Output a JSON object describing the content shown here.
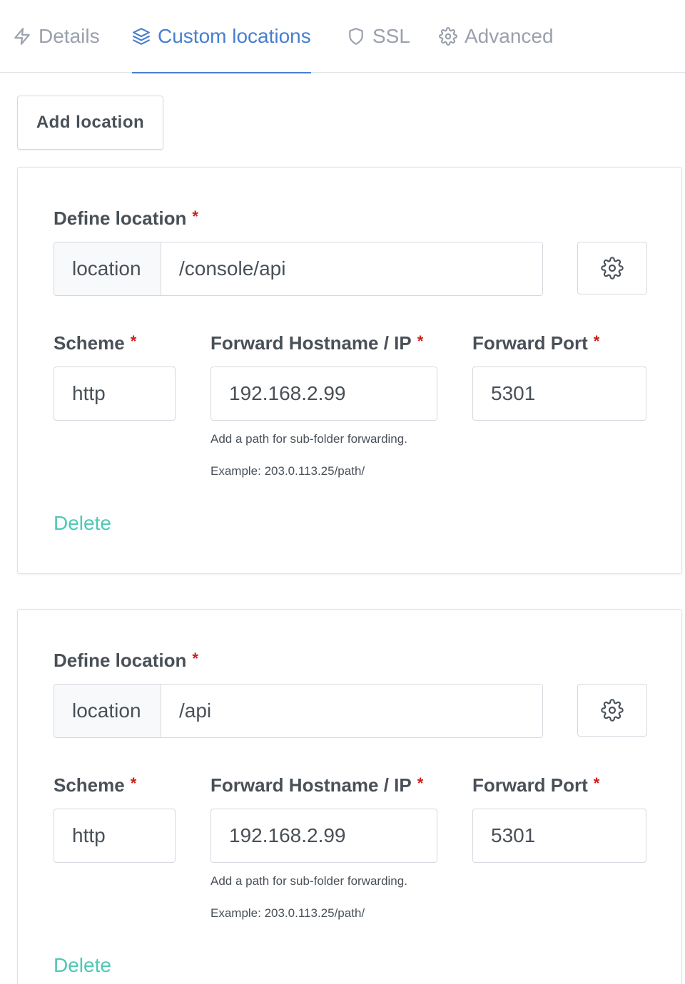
{
  "tabs": [
    {
      "label": "Details",
      "icon": "lightning-icon"
    },
    {
      "label": "Custom locations",
      "icon": "layers-icon"
    },
    {
      "label": "SSL",
      "icon": "shield-icon"
    },
    {
      "label": "Advanced",
      "icon": "gear-icon"
    }
  ],
  "active_tab": "Custom locations",
  "add_location_label": "Add location",
  "colors": {
    "accent": "#467fcf",
    "required": "#cd201f",
    "delete": "#4fc8b4"
  },
  "locations": [
    {
      "define_label": "Define location",
      "addon": "location",
      "path": "/console/api",
      "scheme_label": "Scheme",
      "scheme": "http",
      "hostname_label": "Forward Hostname / IP",
      "hostname": "192.168.2.99",
      "port_label": "Forward Port",
      "port": "5301",
      "help_line1": "Add a path for sub-folder forwarding.",
      "help_line2": "Example: 203.0.113.25/path/",
      "delete_label": "Delete"
    },
    {
      "define_label": "Define location",
      "addon": "location",
      "path": "/api",
      "scheme_label": "Scheme",
      "scheme": "http",
      "hostname_label": "Forward Hostname / IP",
      "hostname": "192.168.2.99",
      "port_label": "Forward Port",
      "port": "5301",
      "help_line1": "Add a path for sub-folder forwarding.",
      "help_line2": "Example: 203.0.113.25/path/",
      "delete_label": "Delete"
    }
  ]
}
